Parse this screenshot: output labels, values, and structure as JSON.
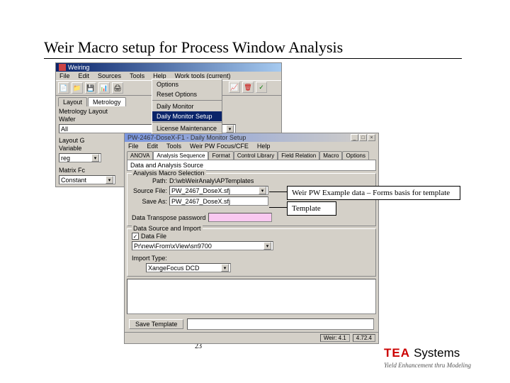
{
  "slide": {
    "title": "Weir Macro setup for Process Window Analysis",
    "page": "23",
    "brand": "TEA Systems",
    "tagline": "Yield Enhancement thru Modeling"
  },
  "app1": {
    "title": "Weiring",
    "menu": [
      "File",
      "Edit",
      "Sources",
      "Tools",
      "Help",
      "Work tools (current)"
    ],
    "tabs": [
      "Layout",
      "Metrology"
    ],
    "section": "Metrology Layout",
    "wafer_label": "Wafer",
    "wafer_value": "All",
    "layout_grp": "Layout G",
    "variable": "Variable",
    "variable_val": "reg",
    "matrix": "Matrix Fc",
    "matrix_val": "Constant"
  },
  "dropdown": {
    "items": [
      "Options",
      "Reset Options",
      "Daily Monitor",
      "Daily Monitor Setup",
      "License Maintenance"
    ]
  },
  "app2": {
    "title": "PW-2467-DoseX-F1 - Daily Monitor Setup",
    "menu": [
      "File",
      "Edit",
      "Tools",
      "Weir PW Focus/CFE",
      "Help"
    ],
    "inner_tabs": [
      "ANOVA",
      "Analysis Sequence",
      "Format",
      "Control Library",
      "Field Relation",
      "Macro",
      "Options"
    ],
    "grp_label": "Data and Analysis Source",
    "macro_sel": "Analysis Macro Selection",
    "path_lbl": "Path:",
    "path_val": "D:\\wbWeirAnaly\\APTemplates",
    "srcfile_lbl": "Source File:",
    "srcfile_val": "PW_2467_DoseX.sfj",
    "saveas_lbl": "Save As:",
    "saveas_val": "PW_2467_DoseX.sfj",
    "pw_lbl": "Data Transpose password",
    "ds_group": "Data Source and Import",
    "chk_label": "Data File",
    "src_path": "Pr\\new\\From\\xView\\sn9700",
    "import_lbl": "Import Type:",
    "import_val": "XangeFocus DCD",
    "save_btn": "Save Template",
    "status_cells": [
      "Weir: 4.1",
      "4.72.4"
    ]
  },
  "callouts": {
    "c1": "Weir PW Example data – Forms basis for template",
    "c2": "Template"
  }
}
